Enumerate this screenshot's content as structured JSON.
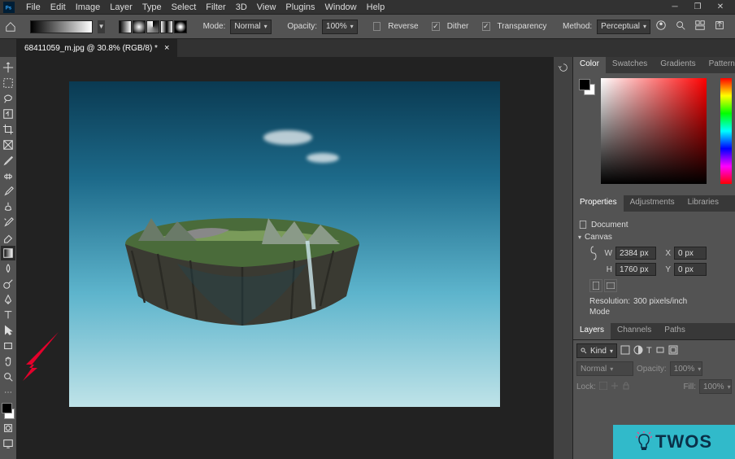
{
  "menu": {
    "items": [
      "File",
      "Edit",
      "Image",
      "Layer",
      "Type",
      "Select",
      "Filter",
      "3D",
      "View",
      "Plugins",
      "Window",
      "Help"
    ]
  },
  "options": {
    "mode_label": "Mode:",
    "mode_value": "Normal",
    "opacity_label": "Opacity:",
    "opacity_value": "100%",
    "reverse_label": "Reverse",
    "dither_label": "Dither",
    "transparency_label": "Transparency",
    "method_label": "Method:",
    "method_value": "Perceptual"
  },
  "document": {
    "tab_title": "68411059_m.jpg @ 30.8% (RGB/8) *"
  },
  "panels": {
    "color_tabs": [
      "Color",
      "Swatches",
      "Gradients",
      "Patterns"
    ],
    "prop_tabs": [
      "Properties",
      "Adjustments",
      "Libraries"
    ],
    "layer_tabs": [
      "Layers",
      "Channels",
      "Paths"
    ]
  },
  "properties": {
    "document_label": "Document",
    "canvas_label": "Canvas",
    "w_label": "W",
    "w_value": "2384 px",
    "h_label": "H",
    "h_value": "1760 px",
    "x_label": "X",
    "x_value": "0 px",
    "y_label": "Y",
    "y_value": "0 px",
    "resolution_label": "Resolution:",
    "resolution_value": "300 pixels/inch",
    "mode_label": "Mode"
  },
  "layers": {
    "kind_label": "Kind",
    "blend_mode": "Normal",
    "opacity_label": "Opacity:",
    "opacity_value": "100%",
    "lock_label": "Lock:",
    "fill_label": "Fill:",
    "fill_value": "100%"
  },
  "watermark": {
    "text": "TWOS"
  }
}
